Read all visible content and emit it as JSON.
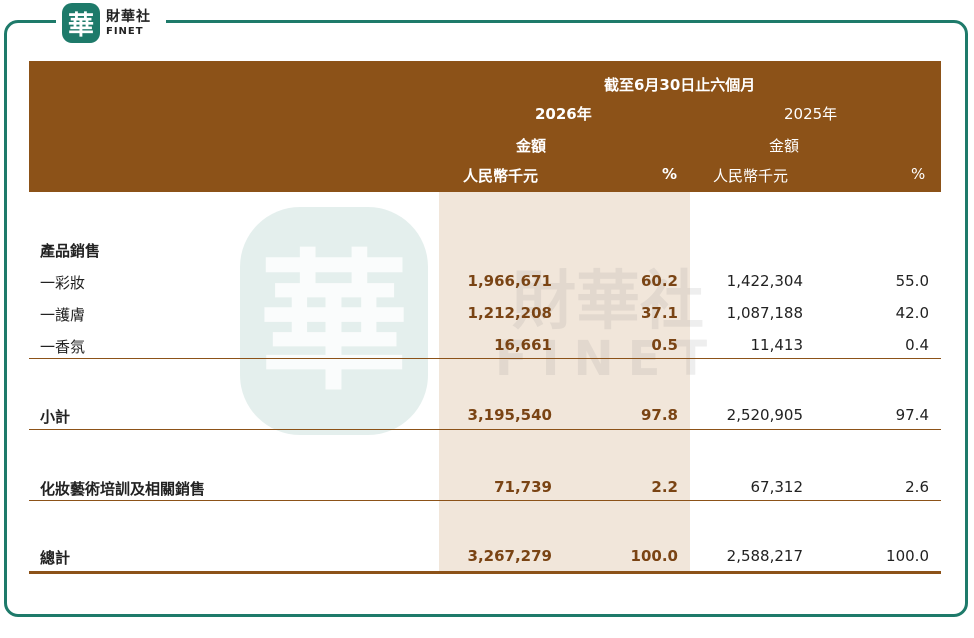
{
  "logo": {
    "seal_char": "華",
    "name_cn": "財華社",
    "name_en": "FINET"
  },
  "watermark": {
    "seal_char": "華",
    "name_cn": "財華社",
    "name_en": "FINET"
  },
  "header": {
    "period": "截至6月30日止六個月",
    "year_current": "2026年",
    "year_prior": "2025年",
    "amount_current": "金額",
    "amount_prior": "金額",
    "unit_current": "人民幣千元",
    "pct_current": "%",
    "unit_prior": "人民幣千元",
    "pct_prior": "%"
  },
  "section_title": "產品銷售",
  "rows": [
    {
      "label": "一彩妝",
      "cur_amount": "1,966,671",
      "cur_pct": "60.2",
      "prior_amount": "1,422,304",
      "prior_pct": "55.0"
    },
    {
      "label": "一護膚",
      "cur_amount": "1,212,208",
      "cur_pct": "37.1",
      "prior_amount": "1,087,188",
      "prior_pct": "42.0"
    },
    {
      "label": "一香氛",
      "cur_amount": "16,661",
      "cur_pct": "0.5",
      "prior_amount": "11,413",
      "prior_pct": "0.4"
    }
  ],
  "subtotal": {
    "label": "小計",
    "cur_amount": "3,195,540",
    "cur_pct": "97.8",
    "prior_amount": "2,520,905",
    "prior_pct": "97.4"
  },
  "training": {
    "label": "化妝藝術培訓及相關銷售",
    "cur_amount": "71,739",
    "cur_pct": "2.2",
    "prior_amount": "67,312",
    "prior_pct": "2.6"
  },
  "total": {
    "label": "總計",
    "cur_amount": "3,267,279",
    "cur_pct": "100.0",
    "prior_amount": "2,588,217",
    "prior_pct": "100.0"
  },
  "colors": {
    "header_bg": "#8c5218",
    "highlight_bg": "#f1e6da",
    "frame": "#1e7a6a",
    "current_text": "#7a4414"
  }
}
